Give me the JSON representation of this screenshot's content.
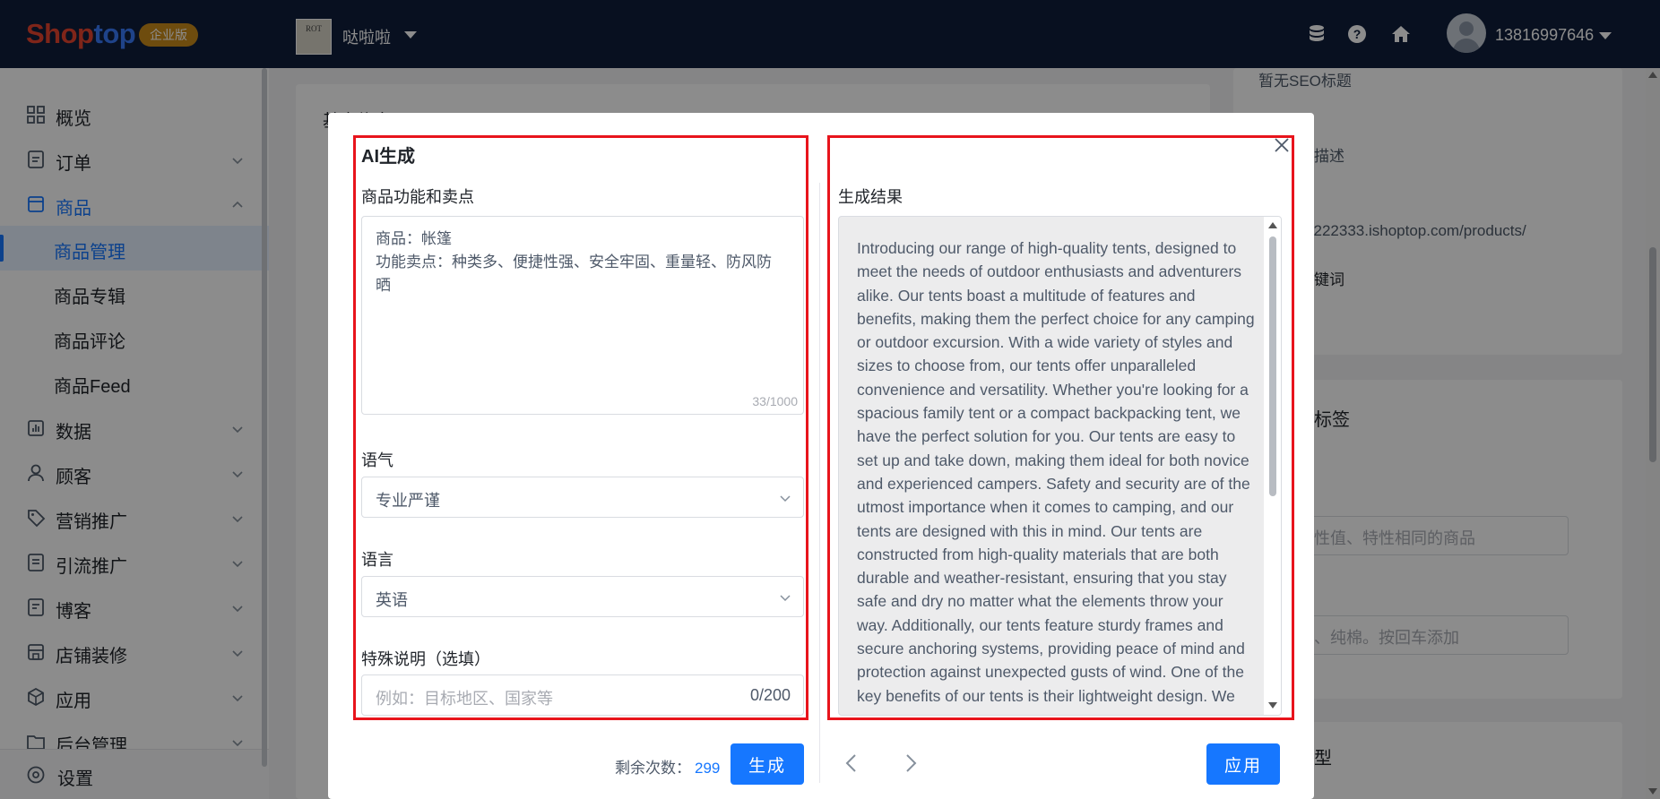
{
  "header": {
    "logo_part1": "Shop",
    "logo_part2": "top",
    "edition_badge": "企业版",
    "store_logo_text": "ROT",
    "store_name": "哒啦啦",
    "user_phone": "13816997646"
  },
  "sidebar": {
    "items": [
      {
        "label": "概览",
        "icon": "dashboard-icon"
      },
      {
        "label": "订单",
        "icon": "order-icon"
      },
      {
        "label": "商品",
        "icon": "product-icon"
      },
      {
        "label": "数据",
        "icon": "chart-icon"
      },
      {
        "label": "顾客",
        "icon": "user-icon"
      },
      {
        "label": "营销推广",
        "icon": "tag-icon"
      },
      {
        "label": "引流推广",
        "icon": "traffic-icon"
      },
      {
        "label": "博客",
        "icon": "blog-icon"
      },
      {
        "label": "店铺装修",
        "icon": "shop-icon"
      },
      {
        "label": "应用",
        "icon": "app-icon"
      },
      {
        "label": "后台管理",
        "icon": "folder-icon"
      }
    ],
    "product_subitems": [
      "商品管理",
      "商品专辑",
      "商品评论",
      "商品Feed"
    ],
    "settings_label": "设置"
  },
  "background": {
    "basic_info": "基本信息",
    "seo_title_empty": "暂无SEO标题",
    "seo_desc_fragment": "描述",
    "url_fragment": "ally222333.ishoptop.com/products/",
    "keywords_fragment": "键词",
    "tags_fragment": "标签",
    "similar_placeholder_fragment": "性值、特性相同的商品",
    "tags_placeholder_fragment": "、纯棉。按回车添加",
    "type_fragment": "型"
  },
  "modal": {
    "title": "AI生成",
    "features_label": "商品功能和卖点",
    "features_lines": [
      "商品：帐篷",
      "功能卖点：种类多、便捷性强、安全牢固、重量轻、防风防",
      "晒"
    ],
    "features_counter": "33/1000",
    "tone_label": "语气",
    "tone_value": "专业严谨",
    "language_label": "语言",
    "language_value": "英语",
    "special_label": "特殊说明（选填）",
    "special_placeholder": "例如：目标地区、国家等",
    "special_counter": "0/200",
    "result_label": "生成结果",
    "result_text": "Introducing our range of high-quality tents, designed to meet the needs of outdoor enthusiasts and adventurers alike. Our tents boast a multitude of features and benefits, making them the perfect choice for any camping or outdoor excursion. With a wide variety of styles and sizes to choose from, our tents offer unparalleled convenience and versatility. Whether you're looking for a spacious family tent or a compact backpacking tent, we have the perfect solution for you. Our tents are easy to set up and take down, making them ideal for both novice and experienced campers. Safety and security are of the utmost importance when it comes to camping, and our tents are designed with this in mind. Our tents are constructed from high-quality materials that are both durable and weather-resistant, ensuring that you stay safe and dry no matter what the elements throw your way. Additionally, our tents feature sturdy frames and secure anchoring systems, providing peace of mind and protection against unexpected gusts of wind. One of the key benefits of our tents is their lightweight design. We",
    "remaining_label": "剩余次数：",
    "remaining_count": "299",
    "generate_button": "生成",
    "apply_button": "应用"
  },
  "colors": {
    "topbar": "#0f1e3b",
    "primary": "#1677ff",
    "highlight_box": "#e8141c",
    "badge": "#c98a1b"
  }
}
